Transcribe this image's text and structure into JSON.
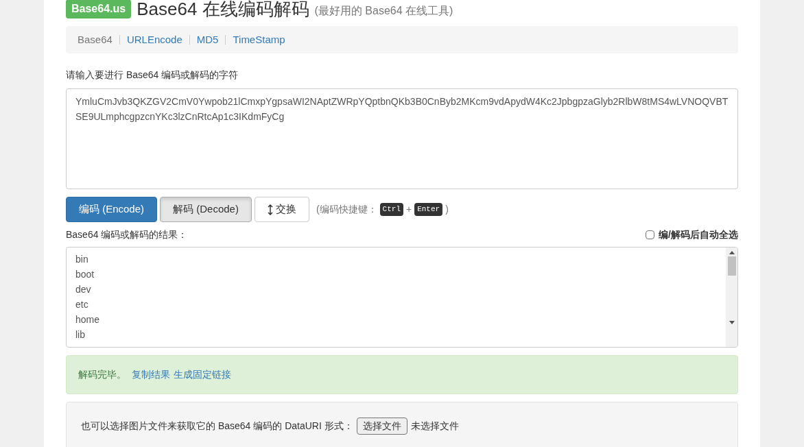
{
  "header": {
    "logo": "Base64.us",
    "title": "Base64 在线编码解码",
    "subtitle": "(最好用的 Base64 在线工具)"
  },
  "nav": [
    {
      "label": "Base64",
      "selected": true
    },
    {
      "label": "URLEncode",
      "selected": false
    },
    {
      "label": "MD5",
      "selected": false
    },
    {
      "label": "TimeStamp",
      "selected": false
    }
  ],
  "input": {
    "label": "请输入要进行 Base64 编码或解码的字符",
    "value": "YmluCmJvb3QKZGV2CmV0Ywpob21lCmxpYgpsaWI2NAptZWRpYQptbnQKb3B0CnByb2MKcm9vdApydW4Kc2JpbgpzaGlyb2RlbW8tMS4wLVNOQVBTSE9ULmphcgpzcnYKc3lzCnRtcAp1c3IKdmFyCg"
  },
  "buttons": [
    {
      "kind": "primary",
      "label": "编码 (Encode)"
    },
    {
      "kind": "active",
      "label": "解码 (Decode)"
    },
    {
      "kind": "swap",
      "label": "交换"
    }
  ],
  "shortcut": {
    "prefix": "(编码快捷键：",
    "keys": [
      "Ctrl",
      "Enter"
    ],
    "joiner": "+",
    "suffix": ")"
  },
  "result": {
    "label": "Base64 编码或解码的结果：",
    "auto_select": {
      "label": "编/解码后自动全选",
      "checked": false
    },
    "lines": [
      "bin",
      "boot",
      "dev",
      "etc",
      "home",
      "lib"
    ]
  },
  "alert": {
    "message": "解码完毕。",
    "links": [
      "复制结果",
      "生成固定链接"
    ]
  },
  "file_panel": {
    "label": "也可以选择图片文件来获取它的 Base64 编码的 DataURI 形式：",
    "button": "选择文件",
    "status": "未选择文件"
  }
}
